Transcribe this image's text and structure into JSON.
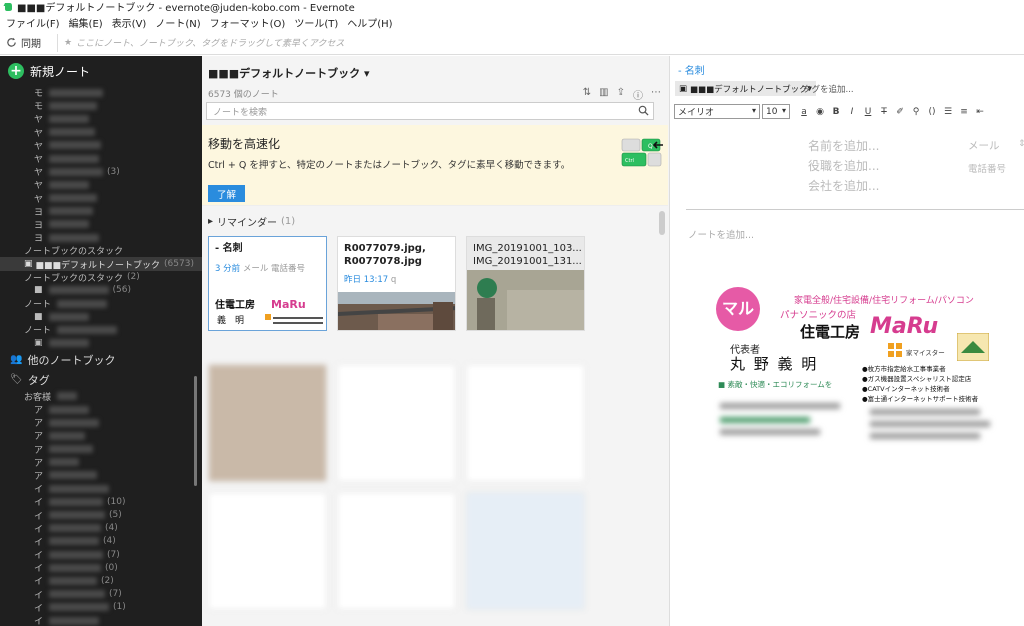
{
  "window": {
    "title": "■■■デフォルトノートブック - evernote@juden-kobo.com - Evernote"
  },
  "menu": {
    "items": [
      "ファイル(F)",
      "編集(E)",
      "表示(V)",
      "ノート(N)",
      "フォーマット(O)",
      "ツール(T)",
      "ヘルプ(H)"
    ]
  },
  "toolbar": {
    "sync_label": "同期",
    "search_hint": "ここにノート、ノートブック、タグをドラッグして素早くアクセス"
  },
  "sidebar": {
    "new_note_label": "新規ノート",
    "shortcut_prefix": [
      "モ",
      "モ",
      "ヤ",
      "ヤ",
      "ヤ",
      "ヤ",
      "ヤ",
      "ヤ",
      "ヤ",
      "ヨ",
      "ヨ",
      "ヨ"
    ],
    "shortcut_counts": [
      "",
      "",
      "",
      "",
      "",
      "",
      "(3)",
      "",
      "",
      "",
      "",
      ""
    ],
    "notebooks_label": "ノートブックのスタック",
    "default_notebook": "■■■デフォルトノートブック",
    "default_notebook_count": "(6573)",
    "stack_label": "ノートブックのスタック",
    "stack_count": "(2)",
    "sub_count": "(56)",
    "other_label": "他のノートブック",
    "tags_label": "タグ",
    "tags_first": "お客様",
    "tag_prefix": [
      "ア",
      "ア",
      "ア",
      "ア",
      "ア",
      "ア",
      "イ",
      "イ",
      "イ",
      "イ",
      "イ",
      "イ",
      "イ",
      "イ",
      "イ",
      "イ",
      "イ"
    ],
    "tag_counts": [
      "",
      "",
      "",
      "",
      "",
      "",
      "",
      "(10)",
      "(5)",
      "(4)",
      "(4)",
      "(7)",
      "(0)",
      "(2)",
      "(7)",
      "(1)",
      ""
    ]
  },
  "note_list": {
    "title": "■■■デフォルトノートブック",
    "count": "6573 個のノート",
    "search_placeholder": "ノートを検索",
    "tip_title": "移動を高速化",
    "tip_body": "Ctrl + Q を押すと、特定のノートまたはノートブック、タグに素早く移動できます。",
    "tip_button": "了解",
    "reminders_label": "リマインダー",
    "reminders_count": "(1)",
    "cards": [
      {
        "title": "- 名刺",
        "date": "3 分前",
        "meta": "メール 電話番号"
      },
      {
        "title": "R0077079.jpg, R0077078.jpg",
        "date": "昨日 13:17",
        "meta": "q"
      },
      {
        "title": "IMG_20191001_103... IMG_20191001_131...",
        "date": "",
        "meta": ""
      }
    ]
  },
  "editor": {
    "title": "- 名刺",
    "notebook": "■■■デフォルトノートブック",
    "tag_placeholder": "タグを追加...",
    "font": "メイリオ",
    "size": "10",
    "name_ph": "名前を追加...",
    "role_ph": "役職を追加...",
    "company_ph": "会社を追加...",
    "email_label": "メール",
    "phone_label": "電話番号",
    "body_ph": "ノートを追加...",
    "card": {
      "maru": "マル",
      "services": "家電全般/住宅設備/住宅リフォーム/パソコン",
      "panasonic": "パナソニックの店",
      "shop": "住電工房",
      "shop_en": "MaRu",
      "rep_label": "代表者",
      "rep_name": "丸 野 義 明",
      "meister": "家マイスター",
      "slogan": "■ 素敵・快適・エコリフォームを",
      "lic1": "●枚方市指定給水工事事業者",
      "lic2": "●ガス機器設置スペシャリスト認定店",
      "lic3": "●CATVインターネット技術者",
      "lic4": "●富士通インターネットサポート技術者"
    }
  }
}
